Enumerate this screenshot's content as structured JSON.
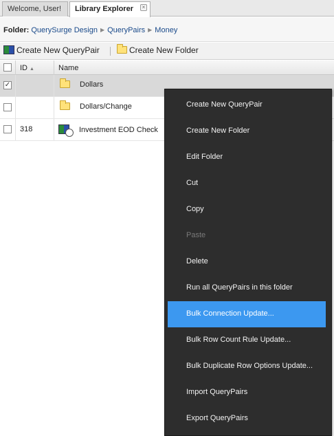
{
  "tabs": [
    {
      "label": "Welcome, User!"
    },
    {
      "label": "Library Explorer",
      "close": "×"
    }
  ],
  "breadcrumb": {
    "label": "Folder:",
    "items": [
      "QuerySurge Design",
      "QueryPairs",
      "Money"
    ],
    "separator": "▶"
  },
  "toolbar": {
    "create_querypair": "Create New QueryPair",
    "create_folder": "Create New Folder"
  },
  "grid": {
    "columns": {
      "id": "ID",
      "name": "Name",
      "sort_indicator": "▲"
    },
    "rows": [
      {
        "checked": "✓",
        "id": "",
        "name": "Dollars",
        "type": "folder-icon"
      },
      {
        "checked": "",
        "id": "",
        "name": "Dollars/Change",
        "type": "folder-icon"
      },
      {
        "checked": "",
        "id": "318",
        "name": "Investment EOD Check",
        "type": "querypair-icon"
      }
    ]
  },
  "context_menu": {
    "items": [
      {
        "label": "Create New QueryPair",
        "state": "normal"
      },
      {
        "label": "Create New Folder",
        "state": "normal"
      },
      {
        "label": "Edit Folder",
        "state": "normal"
      },
      {
        "label": "Cut",
        "state": "normal"
      },
      {
        "label": "Copy",
        "state": "normal"
      },
      {
        "label": "Paste",
        "state": "disabled"
      },
      {
        "label": "Delete",
        "state": "normal"
      },
      {
        "label": "Run all QueryPairs in this folder",
        "state": "normal"
      },
      {
        "label": "Bulk Connection Update...",
        "state": "highlighted"
      },
      {
        "label": "Bulk Row Count Rule Update...",
        "state": "normal"
      },
      {
        "label": "Bulk Duplicate Row Options Update...",
        "state": "normal"
      },
      {
        "label": "Import QueryPairs",
        "state": "normal"
      },
      {
        "label": "Export QueryPairs",
        "state": "normal"
      }
    ]
  },
  "colors": {
    "menu_background": "#2d2d2d",
    "menu_highlight": "#3c98f0",
    "link": "#1a4a8a",
    "selected_row": "#d9d9d9"
  }
}
